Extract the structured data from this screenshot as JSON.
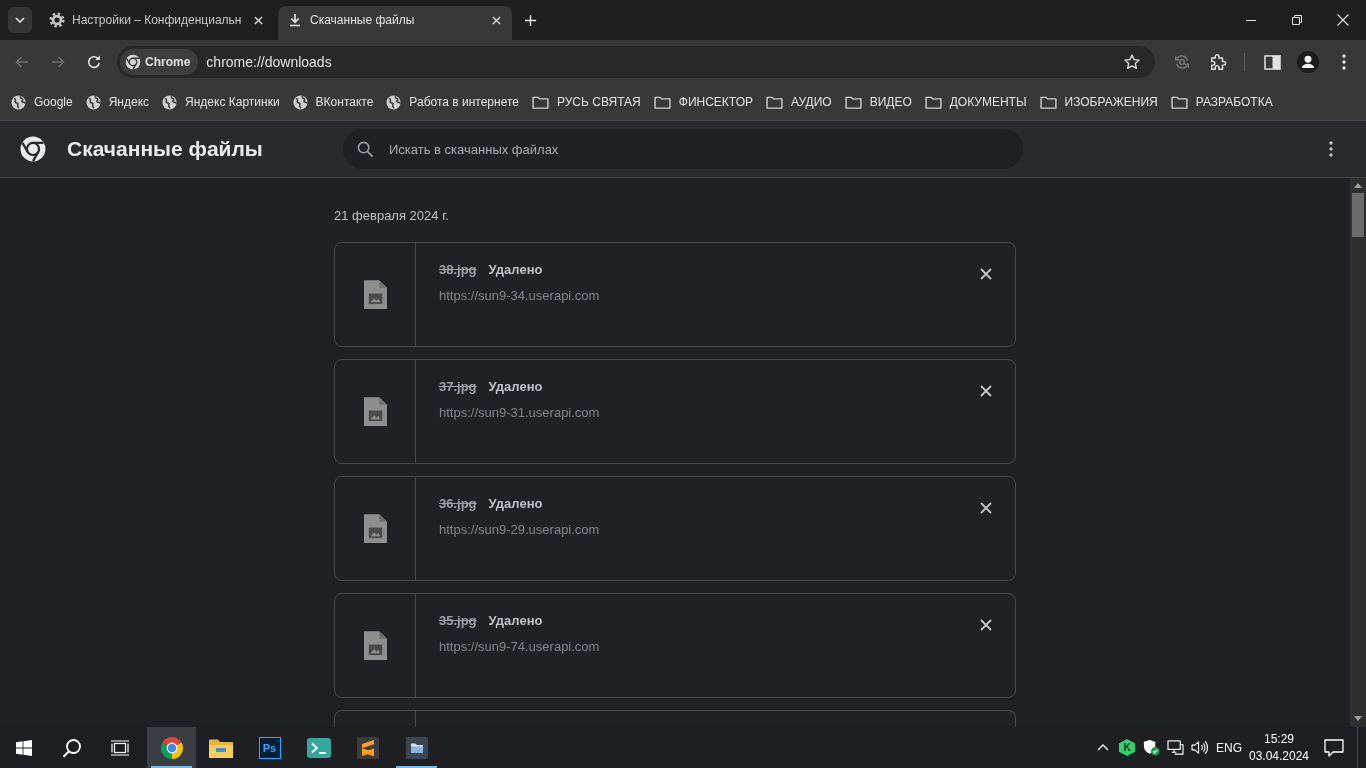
{
  "tabs_bar": {
    "tabs": [
      {
        "kind": "settings",
        "title": "Настройки – Конфиденциальн",
        "selected": false
      },
      {
        "kind": "downloads",
        "title": "Скачанные файлы",
        "selected": true
      }
    ]
  },
  "toolbar": {
    "nav": [
      {
        "kind": "back",
        "disabled": true
      },
      {
        "kind": "forward",
        "disabled": true
      },
      {
        "kind": "reload",
        "disabled": false
      }
    ],
    "omnibox": {
      "chip": "Chrome",
      "url": "chrome://downloads",
      "bookmarked": false
    }
  },
  "bookmarks": [
    {
      "kind": "site",
      "label": "Google"
    },
    {
      "kind": "site",
      "label": "Яндекс"
    },
    {
      "kind": "site",
      "label": "Яндекс Картинки"
    },
    {
      "kind": "site",
      "label": "ВКонтакте"
    },
    {
      "kind": "site",
      "label": "Работа в интернете"
    },
    {
      "kind": "folder",
      "label": "РУСЬ СВЯТАЯ"
    },
    {
      "kind": "folder",
      "label": "ФИНСЕКТОР"
    },
    {
      "kind": "folder",
      "label": "АУДИО"
    },
    {
      "kind": "folder",
      "label": "ВИДЕО"
    },
    {
      "kind": "folder",
      "label": "ДОКУМЕНТЫ"
    },
    {
      "kind": "folder",
      "label": "ИЗОБРАЖЕНИЯ"
    },
    {
      "kind": "folder",
      "label": "РАЗРАБОТКА"
    }
  ],
  "page": {
    "title": "Скачанные файлы",
    "search": {
      "placeholder": "Искать в скачанных файлах"
    },
    "date": "21 февраля 2024 г.",
    "downloads": [
      {
        "name": "38.jpg",
        "status": "Удалено",
        "url": "https://sun9-34.userapi.com",
        "removed": true
      },
      {
        "name": "37.jpg",
        "status": "Удалено",
        "url": "https://sun9-31.userapi.com",
        "removed": true
      },
      {
        "name": "36.jpg",
        "status": "Удалено",
        "url": "https://sun9-29.userapi.com",
        "removed": true
      },
      {
        "name": "35.jpg",
        "status": "Удалено",
        "url": "https://sun9-74.userapi.com",
        "removed": true
      }
    ],
    "more_below": true
  },
  "taskbar": {
    "apps": [
      {
        "kind": "browser",
        "selected": true,
        "running": true
      },
      {
        "kind": "explorer",
        "selected": false,
        "running": false
      },
      {
        "kind": "photoshop",
        "label": "Ps",
        "selected": false,
        "running": false
      },
      {
        "kind": "terminal",
        "selected": false,
        "running": false
      },
      {
        "kind": "editor",
        "selected": false,
        "running": false
      },
      {
        "kind": "files",
        "selected": false,
        "running": true
      }
    ],
    "tray": {
      "badge": "K",
      "language": "ENG",
      "time": "15:29",
      "date": "03.04.2024"
    }
  }
}
